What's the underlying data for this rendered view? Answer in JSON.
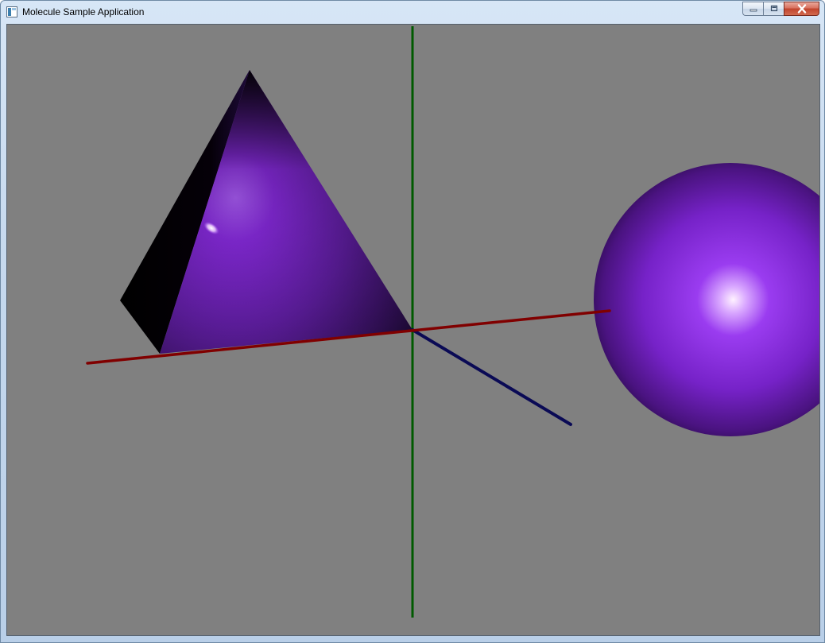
{
  "window": {
    "title": "Molecule Sample Application",
    "icon": "application-window-icon",
    "caption_buttons": [
      "minimize-icon",
      "maximize-icon",
      "close-icon"
    ]
  },
  "scene": {
    "background_color": "#808080",
    "axes": {
      "x_axis_color": "#8b0000",
      "y_axis_color": "#006400",
      "z_axis_color": "#000066"
    },
    "objects": [
      {
        "shape": "pyramid",
        "color": "#8a2be2"
      },
      {
        "shape": "sphere",
        "color": "#8a2be2"
      }
    ]
  }
}
